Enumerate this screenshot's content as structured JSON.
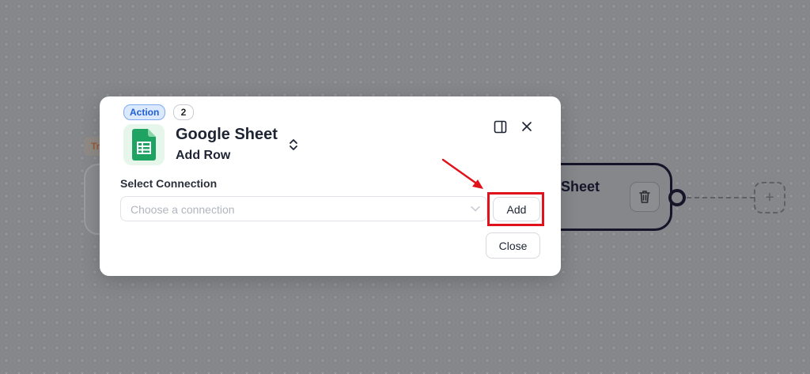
{
  "canvas": {
    "trigger_tag": "Tr",
    "right_node_title": "Sheet",
    "add_step_symbol": "+"
  },
  "modal": {
    "badge_type": "Action",
    "badge_step": "2",
    "app_name": "Google Sheet",
    "action_name": "Add Row",
    "app_icon": "google-sheets-icon",
    "connection": {
      "label": "Select Connection",
      "placeholder": "Choose a connection",
      "value": ""
    },
    "add_label": "Add",
    "close_label": "Close"
  },
  "colors": {
    "accent_blue": "#1f5fd6",
    "sheets_green": "#1ea362",
    "highlight_red": "#e0121b",
    "overlay": "#85878b"
  }
}
